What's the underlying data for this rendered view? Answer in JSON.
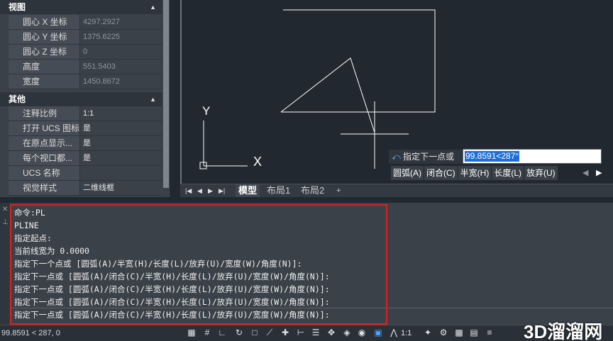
{
  "properties": {
    "sections": [
      {
        "title": "视图",
        "rows": [
          {
            "key": "圆心 X 坐标",
            "value": "4297.2927"
          },
          {
            "key": "圆心 Y 坐标",
            "value": "1375.6225"
          },
          {
            "key": "圆心 Z 坐标",
            "value": "0"
          },
          {
            "key": "高度",
            "value": "551.5403"
          },
          {
            "key": "宽度",
            "value": "1450.8672"
          }
        ]
      },
      {
        "title": "其他",
        "rows": [
          {
            "key": "注释比例",
            "value": "1:1"
          },
          {
            "key": "打开 UCS 图标",
            "value": "是"
          },
          {
            "key": "在原点显示...",
            "value": "是"
          },
          {
            "key": "每个视口都...",
            "value": "是"
          },
          {
            "key": "UCS 名称",
            "value": ""
          },
          {
            "key": "视觉样式",
            "value": "二维线框"
          }
        ]
      }
    ]
  },
  "viewport": {
    "ucs": {
      "y_label": "Y",
      "x_label": "X"
    },
    "dynamic_input": {
      "prompt": "指定下一点或",
      "value": "99.8591<287°",
      "options": [
        "圆弧(A)",
        "闭合(C)",
        "半宽(H)",
        "长度(L)",
        "放弃(U)"
      ]
    }
  },
  "layout_tabs": {
    "nav": [
      "|◀",
      "◀",
      "▶",
      "▶|"
    ],
    "tabs": [
      "模型",
      "布局1",
      "布局2"
    ],
    "add": "+"
  },
  "command_window": {
    "lines": [
      "命令:PL",
      "PLINE",
      "指定起点:",
      "当前线宽为 0.0000",
      "指定下一个点或 [圆弧(A)/半宽(H)/长度(L)/放弃(U)/宽度(W)/角度(N)]:",
      "指定下一点或 [圆弧(A)/闭合(C)/半宽(H)/长度(L)/放弃(U)/宽度(W)/角度(N)]:",
      "指定下一点或 [圆弧(A)/闭合(C)/半宽(H)/长度(L)/放弃(U)/宽度(W)/角度(N)]:",
      "指定下一点或 [圆弧(A)/闭合(C)/半宽(H)/长度(L)/放弃(U)/宽度(W)/角度(N)]:",
      "指定下一点或 [圆弧(A)/闭合(C)/半宽(H)/长度(L)/放弃(U)/宽度(W)/角度(N)]:"
    ],
    "highlight_color": "#e01e1e"
  },
  "status_bar": {
    "coordinates": "99.8591 < 287, 0",
    "annotation_scale": "1:1",
    "icons": [
      "grid-icon",
      "snap-grid-icon",
      "ortho-icon",
      "polar-icon",
      "osnap-icon",
      "otrack-icon",
      "ducs-icon",
      "dyn-icon",
      "lineweight-icon",
      "transparency-icon",
      "selection-cycling-icon",
      "3d-osnap-icon",
      "dyn-ucs-icon",
      "annotation-icon",
      "workspace-icon",
      "isolate-icon",
      "hardware-accel-icon",
      "clean-screen-icon"
    ]
  },
  "watermark": "3D溜溜网"
}
